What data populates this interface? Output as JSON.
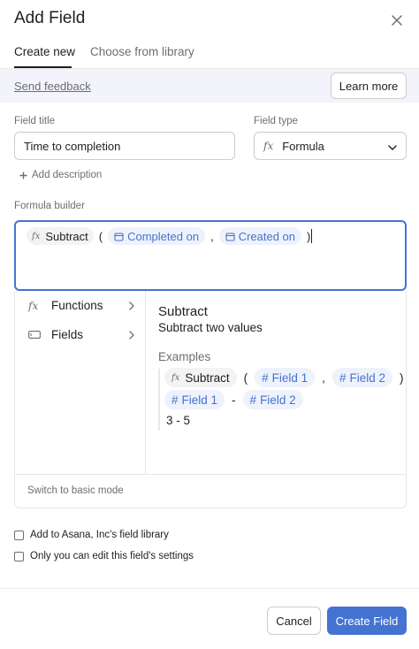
{
  "dialog": {
    "title": "Add Field",
    "close_icon": "close-icon"
  },
  "tabs": [
    {
      "label": "Create new",
      "active": true
    },
    {
      "label": "Choose from library",
      "active": false
    }
  ],
  "feedback": {
    "send_feedback": "Send feedback",
    "learn_more": "Learn more"
  },
  "field_title": {
    "label": "Field title",
    "value": "Time to completion"
  },
  "field_type": {
    "label": "Field type",
    "icon": "fx-icon",
    "value": "Formula"
  },
  "add_description": "Add description",
  "formula_builder": {
    "label": "Formula builder",
    "function": "Subtract",
    "open_paren": "(",
    "arg1": "Completed on",
    "comma": ",",
    "arg2": "Created on",
    "close_paren": ")"
  },
  "menu": {
    "functions": "Functions",
    "fields": "Fields"
  },
  "help": {
    "title": "Subtract",
    "description": "Subtract two values",
    "examples_label": "Examples",
    "example1": {
      "function": "Subtract",
      "open_paren": "(",
      "arg1": "Field 1",
      "comma": ",",
      "arg2": "Field 2",
      "close_paren": ")"
    },
    "example2": {
      "arg1": "Field 1",
      "operator": "-",
      "arg2": "Field 2"
    },
    "example3": "3 - 5"
  },
  "switch_basic_mode": "Switch to basic mode",
  "options": {
    "library": "Add to Asana, Inc's field library",
    "only_you": "Only you can edit this field's settings"
  },
  "actions": {
    "cancel": "Cancel",
    "create": "Create Field"
  },
  "colors": {
    "primary": "#4573d2",
    "chip_field_bg": "#eef2fb",
    "feedback_bg": "#f3f3fb"
  }
}
